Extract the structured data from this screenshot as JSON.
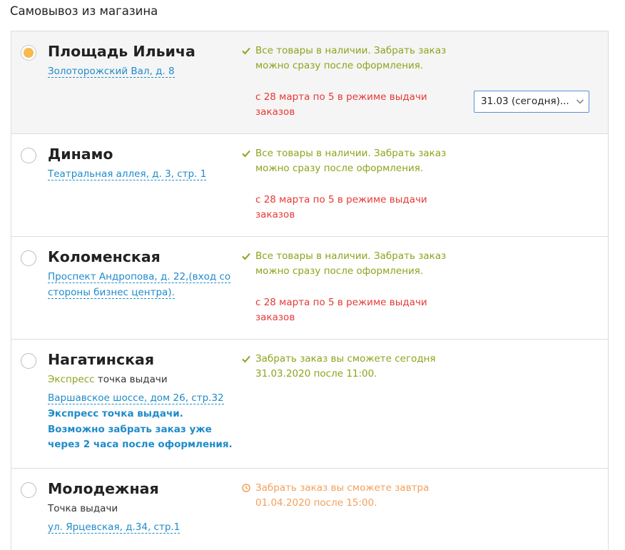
{
  "page": {
    "title": "Самовывоз из магазина"
  },
  "colors": {
    "accent_green": "#8aa51c",
    "link_blue": "#1f8bc9",
    "alert_red": "#e53935",
    "pending_orange": "#f4a05a",
    "radio_selected": "#f6bb4e"
  },
  "stores": [
    {
      "name": "Площадь Ильича",
      "selected": true,
      "address": "Золоторожский Вал, д. 8",
      "availability_icon": "check-icon",
      "availability_line1": "Все товары в наличии. Забрать заказ",
      "availability_line2": "можно сразу после оформления.",
      "mode_line1": "с 28 марта по 5 в режиме выдачи",
      "mode_line2": "заказов",
      "date_select": {
        "value": "31.03 (сегодня)..."
      }
    },
    {
      "name": "Динамо",
      "selected": false,
      "address": "Театральная аллея, д. 3, стр. 1",
      "availability_icon": "check-icon",
      "availability_line1": "Все товары в наличии. Забрать заказ",
      "availability_line2": "можно сразу после оформления.",
      "mode_line1": "с 28 марта по 5 в режиме выдачи",
      "mode_line2": "заказов"
    },
    {
      "name": "Коломенская",
      "selected": false,
      "address_line1": "Проспект Андропова, д. 22,(вход со",
      "address_line2": "стороны бизнес центра).",
      "availability_icon": "check-icon",
      "availability_line1": "Все товары в наличии. Забрать заказ",
      "availability_line2": "можно сразу после оформления.",
      "mode_line1": "с 28 марта по 5 в режиме выдачи",
      "mode_line2": "заказов"
    },
    {
      "name": "Нагатинская",
      "selected": false,
      "type_highlight": "Экспресс",
      "type_rest": " точка выдачи",
      "address": "Варшавское шоссе, дом 26, стр.32",
      "note_line1": "Экспресс точка выдачи.",
      "note_line2": "Возможно забрать заказ уже",
      "note_line3": "через 2 часа после оформления.",
      "availability_icon": "check-icon",
      "availability_line1": "Забрать заказ вы сможете сегодня",
      "availability_line2": "31.03.2020 после 11:00."
    },
    {
      "name": "Молодежная",
      "selected": false,
      "type": "Точка выдачи",
      "address": "ул. Ярцевская, д.34, стр.1",
      "availability_icon": "clock-icon",
      "availability_line1": "Забрать заказ вы сможете завтра",
      "availability_line2": "01.04.2020 после 15:00."
    }
  ]
}
